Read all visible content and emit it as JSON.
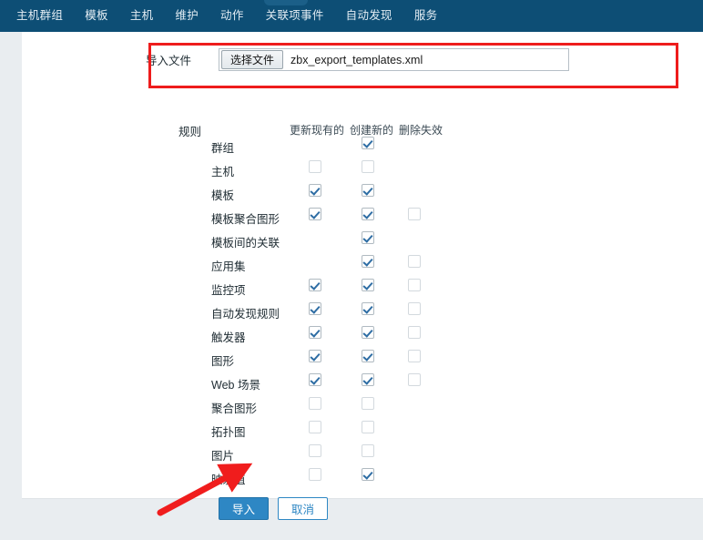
{
  "navbar": {
    "items": [
      {
        "label": "主机群组",
        "name": "nav-host-groups"
      },
      {
        "label": "模板",
        "name": "nav-templates"
      },
      {
        "label": "主机",
        "name": "nav-hosts"
      },
      {
        "label": "维护",
        "name": "nav-maintenance"
      },
      {
        "label": "动作",
        "name": "nav-actions"
      },
      {
        "label": "关联项事件",
        "name": "nav-correlation-events"
      },
      {
        "label": "自动发现",
        "name": "nav-discovery"
      },
      {
        "label": "服务",
        "name": "nav-services"
      }
    ],
    "background_color": "#0d4e75",
    "text_color": "#e3edf4"
  },
  "form": {
    "import_file_label": "导入文件",
    "choose_file_button": "选择文件",
    "file_name": "zbx_export_templates.xml",
    "rules_label": "规则",
    "columns": [
      "更新现有的",
      "创建新的",
      "删除失效"
    ],
    "rows": [
      {
        "label": "群组",
        "c1": "none",
        "c2": "checked",
        "c3": "none"
      },
      {
        "label": "主机",
        "c1": "unchecked",
        "c2": "unchecked",
        "c3": "none"
      },
      {
        "label": "模板",
        "c1": "checked",
        "c2": "checked",
        "c3": "none"
      },
      {
        "label": "模板聚合图形",
        "c1": "checked",
        "c2": "checked",
        "c3": "unchecked"
      },
      {
        "label": "模板间的关联",
        "c1": "none",
        "c2": "checked",
        "c3": "none"
      },
      {
        "label": "应用集",
        "c1": "none",
        "c2": "checked",
        "c3": "unchecked"
      },
      {
        "label": "监控项",
        "c1": "checked",
        "c2": "checked",
        "c3": "unchecked"
      },
      {
        "label": "自动发现规则",
        "c1": "checked",
        "c2": "checked",
        "c3": "unchecked"
      },
      {
        "label": "触发器",
        "c1": "checked",
        "c2": "checked",
        "c3": "unchecked"
      },
      {
        "label": "图形",
        "c1": "checked",
        "c2": "checked",
        "c3": "unchecked"
      },
      {
        "label": "Web 场景",
        "c1": "checked",
        "c2": "checked",
        "c3": "unchecked"
      },
      {
        "label": "聚合图形",
        "c1": "unchecked",
        "c2": "unchecked",
        "c3": "none"
      },
      {
        "label": "拓扑图",
        "c1": "unchecked",
        "c2": "unchecked",
        "c3": "none"
      },
      {
        "label": "图片",
        "c1": "unchecked",
        "c2": "unchecked",
        "c3": "none"
      },
      {
        "label": "映射值",
        "c1": "unchecked",
        "c2": "checked",
        "c3": "none"
      }
    ],
    "submit_button": "导入",
    "cancel_button": "取消"
  },
  "annotations": {
    "highlight_color": "#ee1c1c",
    "arrow_color": "#f01d1d"
  }
}
